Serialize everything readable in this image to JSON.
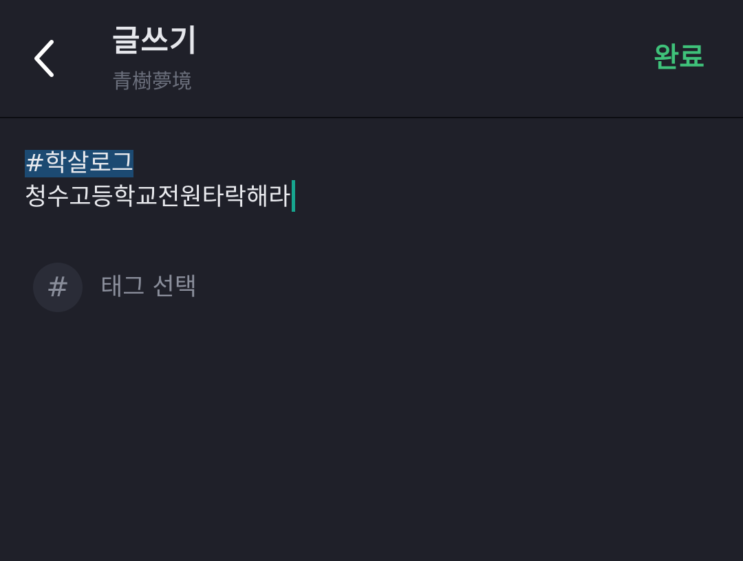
{
  "header": {
    "title": "글쓰기",
    "subtitle": "青樹夢境",
    "done_label": "완료"
  },
  "editor": {
    "tag_text": "#학살로그",
    "body_text": "청수고등학교전원타락해라"
  },
  "tag_select": {
    "hash_glyph": "#",
    "label": "태그 선택"
  },
  "colors": {
    "background": "#1f2029",
    "accent": "#3fc27a",
    "tag_highlight": "#1c4a72",
    "caret": "#17a68f"
  },
  "icons": {
    "back": "chevron-left-icon",
    "hash": "hash-icon"
  }
}
